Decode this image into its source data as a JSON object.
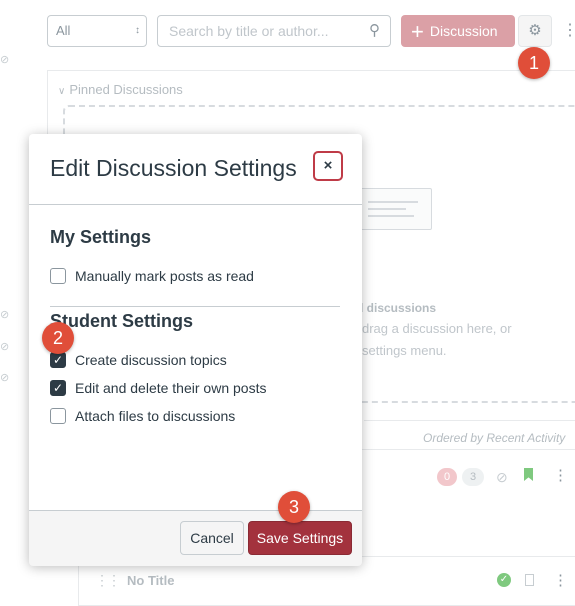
{
  "toolbar": {
    "filter_value": "All",
    "search_placeholder": "Search by title or author...",
    "new_discussion_label": "Discussion"
  },
  "pinned": {
    "header": "Pinned Discussions",
    "empty_title": "d discussions",
    "empty_line1": "drag a discussion here, or",
    "empty_line2": "settings menu."
  },
  "list": {
    "sort_label": "Ordered by Recent Activity",
    "row1": {
      "unread": "0",
      "replies": "3"
    },
    "row2": {
      "title": "No Title"
    }
  },
  "modal": {
    "title": "Edit Discussion Settings",
    "close_label": "×",
    "my_settings_heading": "My Settings",
    "my_settings": [
      {
        "label": "Manually mark posts as read",
        "checked": false
      }
    ],
    "student_settings_heading": "Student Settings",
    "student_settings": [
      {
        "label": "Create discussion topics",
        "checked": true
      },
      {
        "label": "Edit and delete their own posts",
        "checked": true
      },
      {
        "label": "Attach files to discussions",
        "checked": false
      }
    ],
    "cancel_label": "Cancel",
    "save_label": "Save Settings"
  },
  "steps": [
    "1",
    "2",
    "3"
  ],
  "colors": {
    "accent": "#a3323d",
    "callout": "#e04e39",
    "text": "#2d3b45"
  },
  "icons": [
    "chevron-down-icon",
    "search-icon",
    "plus-icon",
    "gear-icon",
    "kebab-icon",
    "close-icon",
    "checkmark-icon",
    "drag-handle-icon",
    "bookmark-icon",
    "published-icon"
  ]
}
